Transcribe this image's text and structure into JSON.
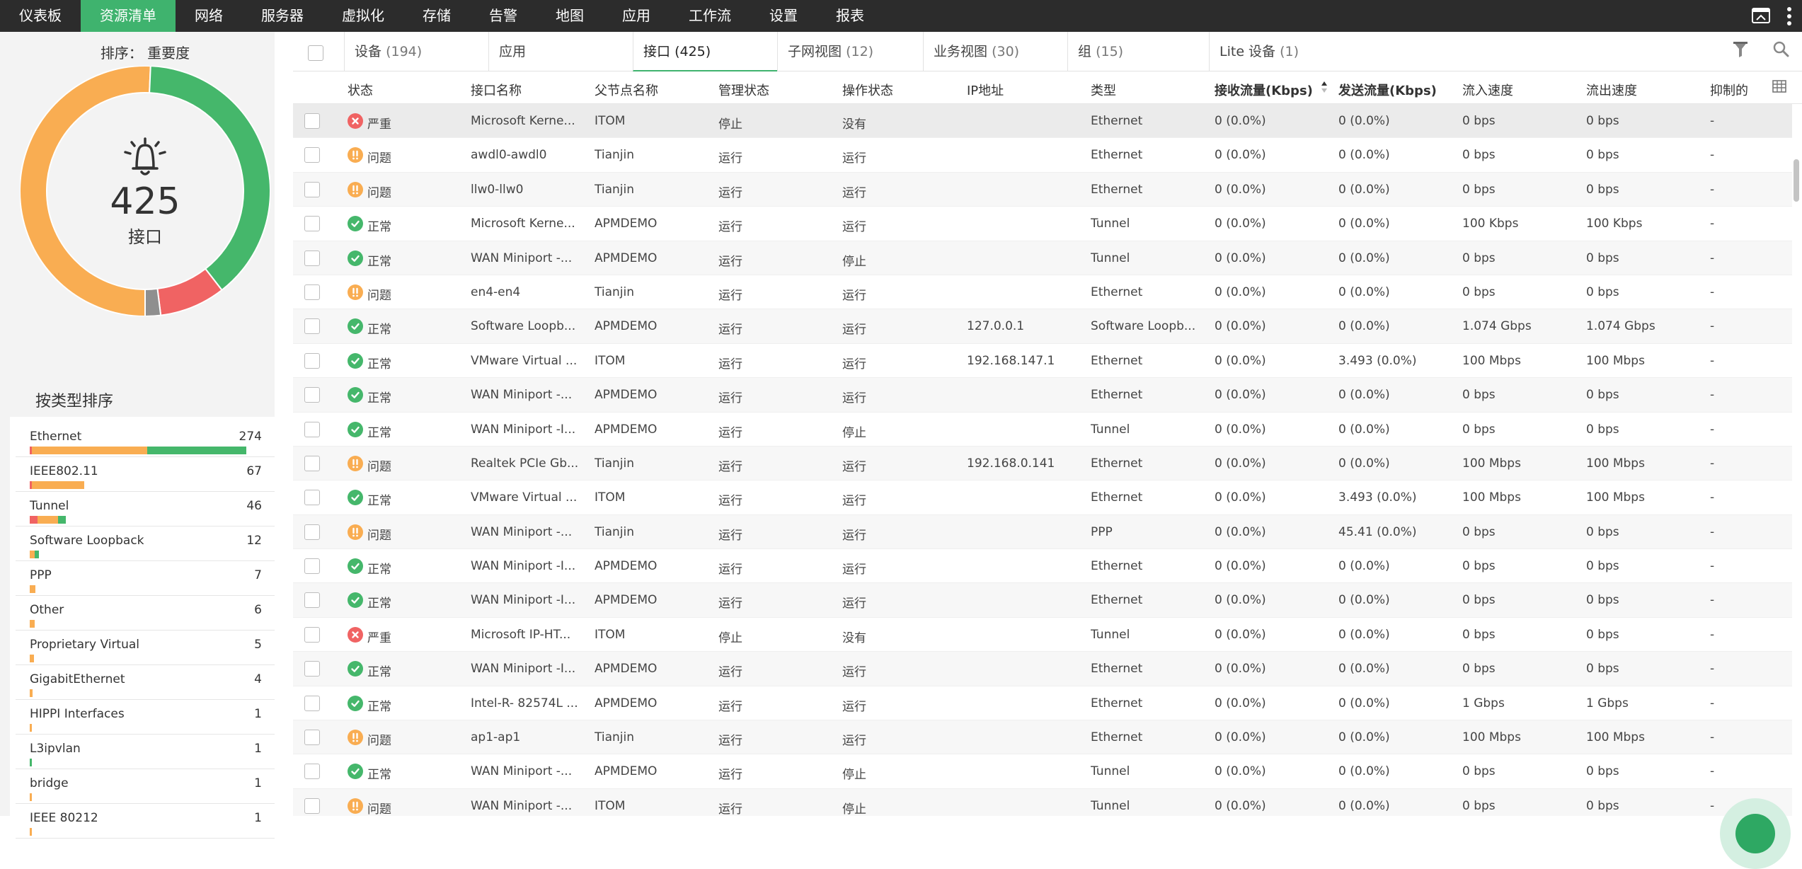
{
  "colors": {
    "accent": "#3fb36e",
    "critical": "#f06363",
    "warning": "#f9ad52",
    "normal": "#45b76b",
    "other": "#8f8f8f"
  },
  "nav": {
    "items": [
      "仪表板",
      "资源清单",
      "网络",
      "服务器",
      "虚拟化",
      "存储",
      "告警",
      "地图",
      "应用",
      "工作流",
      "设置",
      "报表"
    ],
    "active_index": 1,
    "icons": [
      "screen-share-icon",
      "more-vertical-icon"
    ]
  },
  "left": {
    "sort_title": "排序： 重要度",
    "donut": {
      "count": "425",
      "label": "接口",
      "segments": [
        {
          "status": "warning",
          "fraction": 0.507
        },
        {
          "status": "normal",
          "fraction": 0.388
        },
        {
          "status": "critical",
          "fraction": 0.085
        },
        {
          "status": "other",
          "fraction": 0.02
        }
      ]
    },
    "type_title": "按类型排序",
    "types": [
      {
        "name": "Ethernet",
        "count": "274",
        "bar": [
          {
            "c": "critical",
            "v": 3
          },
          {
            "c": "warning",
            "v": 146
          },
          {
            "c": "normal",
            "v": 125
          }
        ]
      },
      {
        "name": "IEEE802.11",
        "count": "67",
        "bar": [
          {
            "c": "critical",
            "v": 1
          },
          {
            "c": "warning",
            "v": 66
          }
        ]
      },
      {
        "name": "Tunnel",
        "count": "46",
        "bar": [
          {
            "c": "critical",
            "v": 10
          },
          {
            "c": "warning",
            "v": 26
          },
          {
            "c": "normal",
            "v": 10
          }
        ]
      },
      {
        "name": "Software Loopback",
        "count": "12",
        "bar": [
          {
            "c": "warning",
            "v": 6
          },
          {
            "c": "normal",
            "v": 6
          }
        ]
      },
      {
        "name": "PPP",
        "count": "7",
        "bar": [
          {
            "c": "warning",
            "v": 7
          }
        ]
      },
      {
        "name": "Other",
        "count": "6",
        "bar": [
          {
            "c": "warning",
            "v": 6
          }
        ]
      },
      {
        "name": "Proprietary Virtual",
        "count": "5",
        "bar": [
          {
            "c": "warning",
            "v": 5
          }
        ]
      },
      {
        "name": "GigabitEthernet",
        "count": "4",
        "bar": [
          {
            "c": "warning",
            "v": 4
          }
        ]
      },
      {
        "name": "HIPPI Interfaces",
        "count": "1",
        "bar": [
          {
            "c": "warning",
            "v": 1
          }
        ]
      },
      {
        "name": "L3ipvlan",
        "count": "1",
        "bar": [
          {
            "c": "normal",
            "v": 1
          }
        ]
      },
      {
        "name": "bridge",
        "count": "1",
        "bar": [
          {
            "c": "warning",
            "v": 1
          }
        ]
      },
      {
        "name": "IEEE 80212",
        "count": "1",
        "bar": [
          {
            "c": "warning",
            "v": 1
          }
        ]
      }
    ]
  },
  "tabs": [
    {
      "label": "设备",
      "count": "(194)"
    },
    {
      "label": "应用",
      "count": ""
    },
    {
      "label": "接口",
      "count": "(425)"
    },
    {
      "label": "子网视图",
      "count": "(12)"
    },
    {
      "label": "业务视图",
      "count": "(30)"
    },
    {
      "label": "组",
      "count": "(15)"
    },
    {
      "label": "Lite 设备",
      "count": "(1)"
    }
  ],
  "active_tab": 2,
  "tab_tools": [
    "filter-icon",
    "search-icon"
  ],
  "columns": [
    "状态",
    "接口名称",
    "父节点名称",
    "管理状态",
    "操作状态",
    "IP地址",
    "类型",
    "接收流量(Kbps)",
    "发送流量(Kbps)",
    "流入速度",
    "流出速度",
    "抑制的"
  ],
  "sorted_column": 7,
  "rows": [
    {
      "status": "critical",
      "status_text": "严重",
      "name": "Microsoft Kerne...",
      "parent": "ITOM",
      "admin": "停止",
      "oper": "没有",
      "ip": "",
      "type": "Ethernet",
      "rx": "0 (0.0%)",
      "tx": "0 (0.0%)",
      "in": "0 bps",
      "out": "0 bps",
      "sup": "-"
    },
    {
      "status": "warning",
      "status_text": "问题",
      "name": "awdl0-awdl0",
      "parent": "Tianjin",
      "admin": "运行",
      "oper": "运行",
      "ip": "",
      "type": "Ethernet",
      "rx": "0 (0.0%)",
      "tx": "0 (0.0%)",
      "in": "0 bps",
      "out": "0 bps",
      "sup": "-"
    },
    {
      "status": "warning",
      "status_text": "问题",
      "name": "llw0-llw0",
      "parent": "Tianjin",
      "admin": "运行",
      "oper": "运行",
      "ip": "",
      "type": "Ethernet",
      "rx": "0 (0.0%)",
      "tx": "0 (0.0%)",
      "in": "0 bps",
      "out": "0 bps",
      "sup": "-"
    },
    {
      "status": "normal",
      "status_text": "正常",
      "name": "Microsoft Kerne...",
      "parent": "APMDEMO",
      "admin": "运行",
      "oper": "运行",
      "ip": "",
      "type": "Tunnel",
      "rx": "0 (0.0%)",
      "tx": "0 (0.0%)",
      "in": "100 Kbps",
      "out": "100 Kbps",
      "sup": "-"
    },
    {
      "status": "normal",
      "status_text": "正常",
      "name": "WAN Miniport -...",
      "parent": "APMDEMO",
      "admin": "运行",
      "oper": "停止",
      "ip": "",
      "type": "Tunnel",
      "rx": "0 (0.0%)",
      "tx": "0 (0.0%)",
      "in": "0 bps",
      "out": "0 bps",
      "sup": "-"
    },
    {
      "status": "warning",
      "status_text": "问题",
      "name": "en4-en4",
      "parent": "Tianjin",
      "admin": "运行",
      "oper": "运行",
      "ip": "",
      "type": "Ethernet",
      "rx": "0 (0.0%)",
      "tx": "0 (0.0%)",
      "in": "0 bps",
      "out": "0 bps",
      "sup": "-"
    },
    {
      "status": "normal",
      "status_text": "正常",
      "name": "Software Loopb...",
      "parent": "APMDEMO",
      "admin": "运行",
      "oper": "运行",
      "ip": "127.0.0.1",
      "type": "Software Loopb...",
      "rx": "0 (0.0%)",
      "tx": "0 (0.0%)",
      "in": "1.074 Gbps",
      "out": "1.074 Gbps",
      "sup": "-"
    },
    {
      "status": "normal",
      "status_text": "正常",
      "name": "VMware Virtual ...",
      "parent": "ITOM",
      "admin": "运行",
      "oper": "运行",
      "ip": "192.168.147.1",
      "type": "Ethernet",
      "rx": "0 (0.0%)",
      "tx": "3.493 (0.0%)",
      "in": "100 Mbps",
      "out": "100 Mbps",
      "sup": "-"
    },
    {
      "status": "normal",
      "status_text": "正常",
      "name": "WAN Miniport -...",
      "parent": "APMDEMO",
      "admin": "运行",
      "oper": "运行",
      "ip": "",
      "type": "Ethernet",
      "rx": "0 (0.0%)",
      "tx": "0 (0.0%)",
      "in": "0 bps",
      "out": "0 bps",
      "sup": "-"
    },
    {
      "status": "normal",
      "status_text": "正常",
      "name": "WAN Miniport -I...",
      "parent": "APMDEMO",
      "admin": "运行",
      "oper": "停止",
      "ip": "",
      "type": "Tunnel",
      "rx": "0 (0.0%)",
      "tx": "0 (0.0%)",
      "in": "0 bps",
      "out": "0 bps",
      "sup": "-"
    },
    {
      "status": "warning",
      "status_text": "问题",
      "name": "Realtek PCIe Gb...",
      "parent": "Tianjin",
      "admin": "运行",
      "oper": "运行",
      "ip": "192.168.0.141",
      "type": "Ethernet",
      "rx": "0 (0.0%)",
      "tx": "0 (0.0%)",
      "in": "100 Mbps",
      "out": "100 Mbps",
      "sup": "-"
    },
    {
      "status": "normal",
      "status_text": "正常",
      "name": "VMware Virtual ...",
      "parent": "ITOM",
      "admin": "运行",
      "oper": "运行",
      "ip": "",
      "type": "Ethernet",
      "rx": "0 (0.0%)",
      "tx": "3.493 (0.0%)",
      "in": "100 Mbps",
      "out": "100 Mbps",
      "sup": "-"
    },
    {
      "status": "warning",
      "status_text": "问题",
      "name": "WAN Miniport -...",
      "parent": "Tianjin",
      "admin": "运行",
      "oper": "运行",
      "ip": "",
      "type": "PPP",
      "rx": "0 (0.0%)",
      "tx": "45.41 (0.0%)",
      "in": "0 bps",
      "out": "0 bps",
      "sup": "-"
    },
    {
      "status": "normal",
      "status_text": "正常",
      "name": "WAN Miniport -I...",
      "parent": "APMDEMO",
      "admin": "运行",
      "oper": "运行",
      "ip": "",
      "type": "Ethernet",
      "rx": "0 (0.0%)",
      "tx": "0 (0.0%)",
      "in": "0 bps",
      "out": "0 bps",
      "sup": "-"
    },
    {
      "status": "normal",
      "status_text": "正常",
      "name": "WAN Miniport -I...",
      "parent": "APMDEMO",
      "admin": "运行",
      "oper": "运行",
      "ip": "",
      "type": "Ethernet",
      "rx": "0 (0.0%)",
      "tx": "0 (0.0%)",
      "in": "0 bps",
      "out": "0 bps",
      "sup": "-"
    },
    {
      "status": "critical",
      "status_text": "严重",
      "name": "Microsoft IP-HT...",
      "parent": "ITOM",
      "admin": "停止",
      "oper": "没有",
      "ip": "",
      "type": "Tunnel",
      "rx": "0 (0.0%)",
      "tx": "0 (0.0%)",
      "in": "0 bps",
      "out": "0 bps",
      "sup": "-"
    },
    {
      "status": "normal",
      "status_text": "正常",
      "name": "WAN Miniport -I...",
      "parent": "APMDEMO",
      "admin": "运行",
      "oper": "运行",
      "ip": "",
      "type": "Ethernet",
      "rx": "0 (0.0%)",
      "tx": "0 (0.0%)",
      "in": "0 bps",
      "out": "0 bps",
      "sup": "-"
    },
    {
      "status": "normal",
      "status_text": "正常",
      "name": "Intel-R- 82574L ...",
      "parent": "APMDEMO",
      "admin": "运行",
      "oper": "运行",
      "ip": "",
      "type": "Ethernet",
      "rx": "0 (0.0%)",
      "tx": "0 (0.0%)",
      "in": "1 Gbps",
      "out": "1 Gbps",
      "sup": "-"
    },
    {
      "status": "warning",
      "status_text": "问题",
      "name": "ap1-ap1",
      "parent": "Tianjin",
      "admin": "运行",
      "oper": "运行",
      "ip": "",
      "type": "Ethernet",
      "rx": "0 (0.0%)",
      "tx": "0 (0.0%)",
      "in": "100 Mbps",
      "out": "100 Mbps",
      "sup": "-"
    },
    {
      "status": "normal",
      "status_text": "正常",
      "name": "WAN Miniport -...",
      "parent": "APMDEMO",
      "admin": "运行",
      "oper": "停止",
      "ip": "",
      "type": "Tunnel",
      "rx": "0 (0.0%)",
      "tx": "0 (0.0%)",
      "in": "0 bps",
      "out": "0 bps",
      "sup": "-"
    },
    {
      "status": "warning",
      "status_text": "问题",
      "name": "WAN Miniport -...",
      "parent": "ITOM",
      "admin": "运行",
      "oper": "停止",
      "ip": "",
      "type": "Tunnel",
      "rx": "0 (0.0%)",
      "tx": "0 (0.0%)",
      "in": "0 bps",
      "out": "0 bps",
      "sup": "-"
    }
  ]
}
